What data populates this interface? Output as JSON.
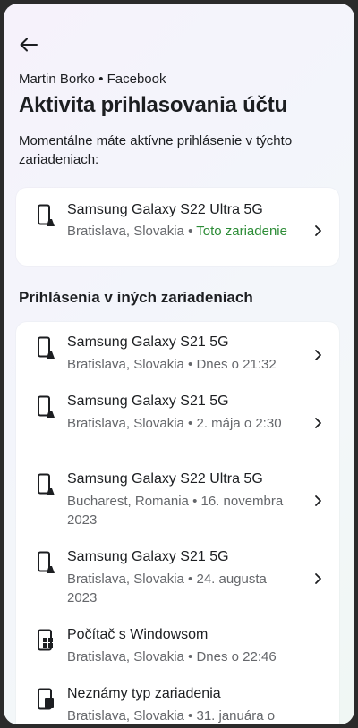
{
  "header": {
    "account": "Martin Borko • Facebook",
    "title": "Aktivita prihlasovania účtu",
    "description": "Momentálne máte aktívne prihlásenie v týchto zariadeniach:"
  },
  "current_device": {
    "name": "Samsung Galaxy S22 Ultra 5G",
    "location": "Bratislava, Slovakia",
    "separator": " • ",
    "this_device_label": "Toto zariadenie",
    "icon": "phone-icon"
  },
  "other_section": {
    "title": "Prihlásenia v iných zariadeniach"
  },
  "other_devices": [
    {
      "name": "Samsung Galaxy S21 5G",
      "meta": "Bratislava, Slovakia • Dnes o 21:32",
      "icon": "phone-icon"
    },
    {
      "name": "Samsung Galaxy S21 5G",
      "meta": "Bratislava, Slovakia • 2. mája o 2:30",
      "icon": "phone-icon"
    },
    {
      "name": "Samsung Galaxy S22 Ultra 5G",
      "meta": "Bucharest, Romania • 16. novembra 2023",
      "icon": "phone-icon"
    },
    {
      "name": "Samsung Galaxy S21 5G",
      "meta": "Bratislava, Slovakia • 24. augusta 2023",
      "icon": "phone-icon"
    },
    {
      "name": "Počítač s Windowsom",
      "meta": "Bratislava, Slovakia • Dnes o 22:46",
      "icon": "windows-icon"
    },
    {
      "name": "Neznámy typ zariadenia",
      "meta": "Bratislava, Slovakia • 31. januára o",
      "icon": "unknown-device-icon"
    }
  ]
}
